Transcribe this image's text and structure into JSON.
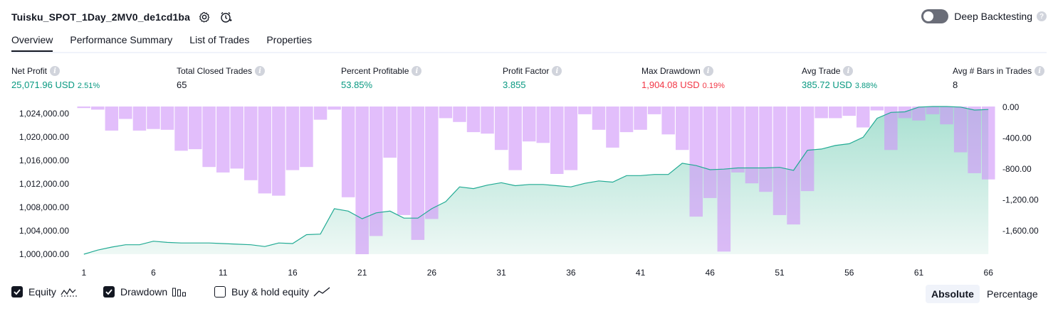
{
  "header": {
    "title": "Tuisku_SPOT_1Day_2MV0_de1cd1ba",
    "deep_backtesting_label": "Deep Backtesting",
    "deep_backtesting_enabled": false
  },
  "tabs": [
    "Overview",
    "Performance Summary",
    "List of Trades",
    "Properties"
  ],
  "active_tab": "Overview",
  "stats": {
    "net_profit": {
      "label": "Net Profit",
      "value": "25,071.96 USD",
      "sub": "2.51%"
    },
    "total_closed_trades": {
      "label": "Total Closed Trades",
      "value": "65"
    },
    "percent_profitable": {
      "label": "Percent Profitable",
      "value": "53.85%"
    },
    "profit_factor": {
      "label": "Profit Factor",
      "value": "3.855"
    },
    "max_drawdown": {
      "label": "Max Drawdown",
      "value": "1,904.08 USD",
      "sub": "0.19%"
    },
    "avg_trade": {
      "label": "Avg Trade",
      "value": "385.72 USD",
      "sub": "3.88%"
    },
    "avg_bars": {
      "label": "Avg # Bars in Trades",
      "value": "8"
    }
  },
  "colors": {
    "positive": "#089981",
    "negative": "#f23645",
    "equity_line": "#22ab94",
    "drawdown_bar": "#ce93f8"
  },
  "chart_data": {
    "type": "bar+area",
    "x": [
      1,
      2,
      3,
      4,
      5,
      6,
      7,
      8,
      9,
      10,
      11,
      12,
      13,
      14,
      15,
      16,
      17,
      18,
      19,
      20,
      21,
      22,
      23,
      24,
      25,
      26,
      27,
      28,
      29,
      30,
      31,
      32,
      33,
      34,
      35,
      36,
      37,
      38,
      39,
      40,
      41,
      42,
      43,
      44,
      45,
      46,
      47,
      48,
      49,
      50,
      51,
      52,
      53,
      54,
      55,
      56,
      57,
      58,
      59,
      60,
      61,
      62,
      63,
      64,
      65,
      66
    ],
    "x_ticks": [
      "1",
      "6",
      "11",
      "16",
      "21",
      "26",
      "31",
      "36",
      "41",
      "46",
      "51",
      "56",
      "61",
      "66"
    ],
    "y_left_ticks": [
      "1,024,000.00",
      "1,020,000.00",
      "1,016,000.00",
      "1,012,000.00",
      "1,008,000.00",
      "1,004,000.00",
      "1,000,000.00"
    ],
    "y_right_ticks": [
      "0.00",
      "-400.00",
      "-800.00",
      "-1,200.00",
      "-1,600.00"
    ],
    "ylim_left": [
      1000000,
      1025000
    ],
    "ylim_right": [
      -1904,
      0
    ],
    "series": [
      {
        "name": "Equity",
        "kind": "area",
        "values": [
          1000000,
          1000700,
          1001200,
          1001600,
          1001600,
          1002200,
          1002000,
          1001900,
          1001900,
          1001900,
          1001800,
          1001700,
          1001600,
          1001300,
          1001900,
          1001800,
          1003300,
          1003400,
          1007700,
          1007300,
          1006000,
          1007000,
          1007300,
          1006100,
          1006100,
          1007700,
          1008900,
          1011400,
          1011100,
          1011700,
          1012100,
          1011600,
          1011800,
          1011800,
          1011600,
          1011400,
          1012000,
          1012400,
          1012200,
          1013300,
          1013300,
          1013500,
          1013500,
          1015400,
          1015000,
          1014300,
          1014400,
          1014600,
          1014600,
          1014600,
          1014700,
          1014200,
          1017600,
          1017800,
          1018400,
          1018700,
          1019800,
          1023000,
          1024000,
          1024100,
          1024900,
          1025000,
          1025000,
          1024900,
          1024400,
          1024500
        ]
      },
      {
        "name": "Drawdown",
        "kind": "bar",
        "values": [
          -20,
          -40,
          -310,
          -160,
          -310,
          -290,
          -300,
          -570,
          -550,
          -780,
          -850,
          -800,
          -950,
          -1120,
          -1150,
          -820,
          -780,
          -170,
          -40,
          -1170,
          -1904,
          -1670,
          -660,
          -1400,
          -1720,
          -1450,
          -150,
          -200,
          -330,
          -350,
          -560,
          -820,
          -450,
          -470,
          -870,
          -820,
          -100,
          -300,
          -530,
          -330,
          -300,
          -100,
          -360,
          -560,
          -1420,
          -1180,
          -1870,
          -850,
          -990,
          -1100,
          -1400,
          -1520,
          -1090,
          -150,
          -150,
          -120,
          -270,
          -50,
          -560,
          -150,
          -180,
          -100,
          -230,
          -590,
          -860,
          -940
        ]
      }
    ]
  },
  "legend": [
    {
      "label": "Equity",
      "checked": true,
      "icon": "equity-wave-icon"
    },
    {
      "label": "Drawdown",
      "checked": true,
      "icon": "drawdown-bars-icon"
    },
    {
      "label": "Buy & hold equity",
      "checked": false,
      "icon": "buy-hold-line-icon"
    }
  ],
  "view_modes": [
    "Absolute",
    "Percentage"
  ],
  "active_view_mode": "Absolute"
}
